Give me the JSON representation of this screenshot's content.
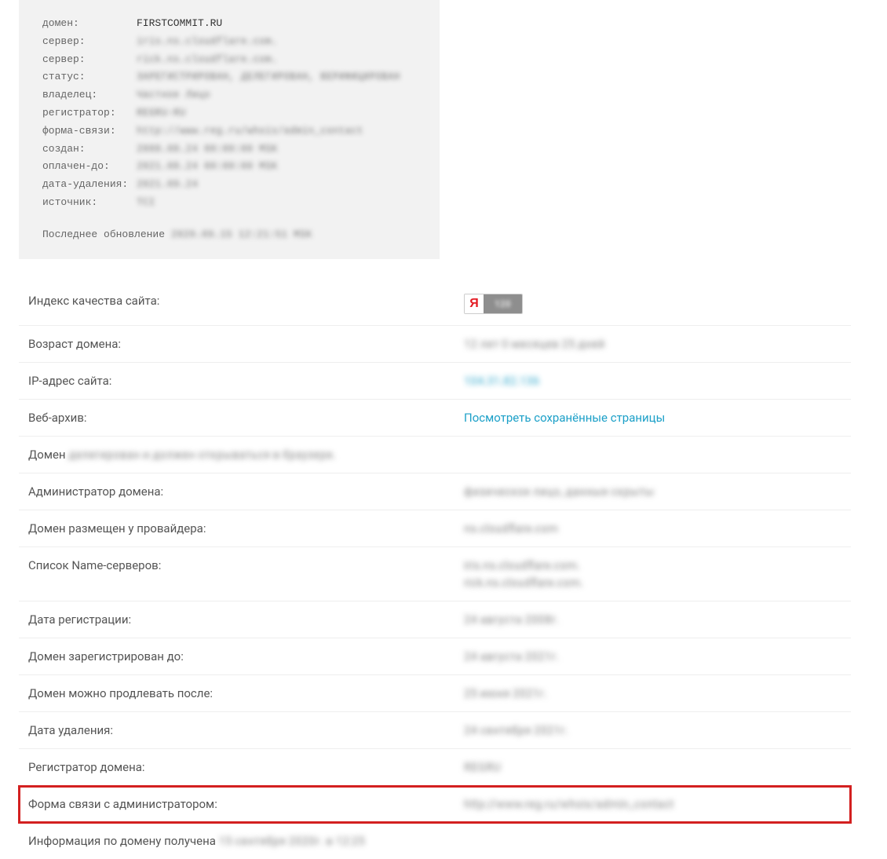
{
  "whois": {
    "rows": [
      {
        "key": "домен:",
        "value": "FIRSTCOMMIT.RU",
        "blurred": false
      },
      {
        "key": "сервер:",
        "value": "iris.ns.cloudflare.com.",
        "blurred": true
      },
      {
        "key": "сервер:",
        "value": "rick.ns.cloudflare.com.",
        "blurred": true
      },
      {
        "key": "статус:",
        "value": "ЗАРЕГИСТРИРОВАН, ДЕЛЕГИРОВАН, ВЕРИФИЦИРОВАН",
        "blurred": true
      },
      {
        "key": "владелец:",
        "value": "Частное Лицо",
        "blurred": true
      },
      {
        "key": "регистратор:",
        "value": "REGRU-RU",
        "blurred": true
      },
      {
        "key": "форма-связи:",
        "value": "http://www.reg.ru/whois/admin_contact",
        "blurred": true
      },
      {
        "key": "создан:",
        "value": "2008.08.24 00:00:00 MSK",
        "blurred": true
      },
      {
        "key": "оплачен-до:",
        "value": "2021.08.24 00:00:00 MSK",
        "blurred": true
      },
      {
        "key": "дата-удаления:",
        "value": "2021.09.24",
        "blurred": true
      },
      {
        "key": "источник:",
        "value": "TCI",
        "blurred": true
      }
    ],
    "footer_label": "Последнее обновление ",
    "footer_value": "2020.09.15 12:21:51 MSK"
  },
  "details": {
    "quality_label": "Индекс качества сайта:",
    "yandex_letter": "Я",
    "yandex_score": "120",
    "age_label": "Возраст домена:",
    "age_value": "12 лет 0 месяцев 25 дней",
    "ip_label": "IP-адрес сайта:",
    "ip_value": "104.31.82.136",
    "archive_label": "Веб-архив:",
    "archive_value": "Посмотреть сохранённые страницы",
    "delegated_prefix": "Домен ",
    "delegated_value": "делегирован и должен открываться в браузере.",
    "admin_label": "Администратор домена:",
    "admin_value": "физическое лицо, данные скрыты",
    "provider_label": "Домен размещен у провайдера:",
    "provider_value": "ns.cloudflare.com",
    "ns_label": "Список Name-серверов:",
    "ns_value1": "iris.ns.cloudflare.com.",
    "ns_value2": "rick.ns.cloudflare.com.",
    "regdate_label": "Дата регистрации:",
    "regdate_value": "24 августа 2008г.",
    "reguntil_label": "Домен зарегистрирован до:",
    "reguntil_value": "24 августа 2021г.",
    "renew_label": "Домен можно продлевать после:",
    "renew_value": "25 июня 2021г.",
    "delete_label": "Дата удаления:",
    "delete_value": "24 сентября 2021г.",
    "registrar_label": "Регистратор домена:",
    "registrar_value": "REGRU",
    "contact_label": "Форма связи с администратором:",
    "contact_value": "http://www.reg.ru/whois/admin_contact",
    "info_prefix": "Информация по домену получена ",
    "info_value": "15 сентября 2020г. в 12:25"
  }
}
